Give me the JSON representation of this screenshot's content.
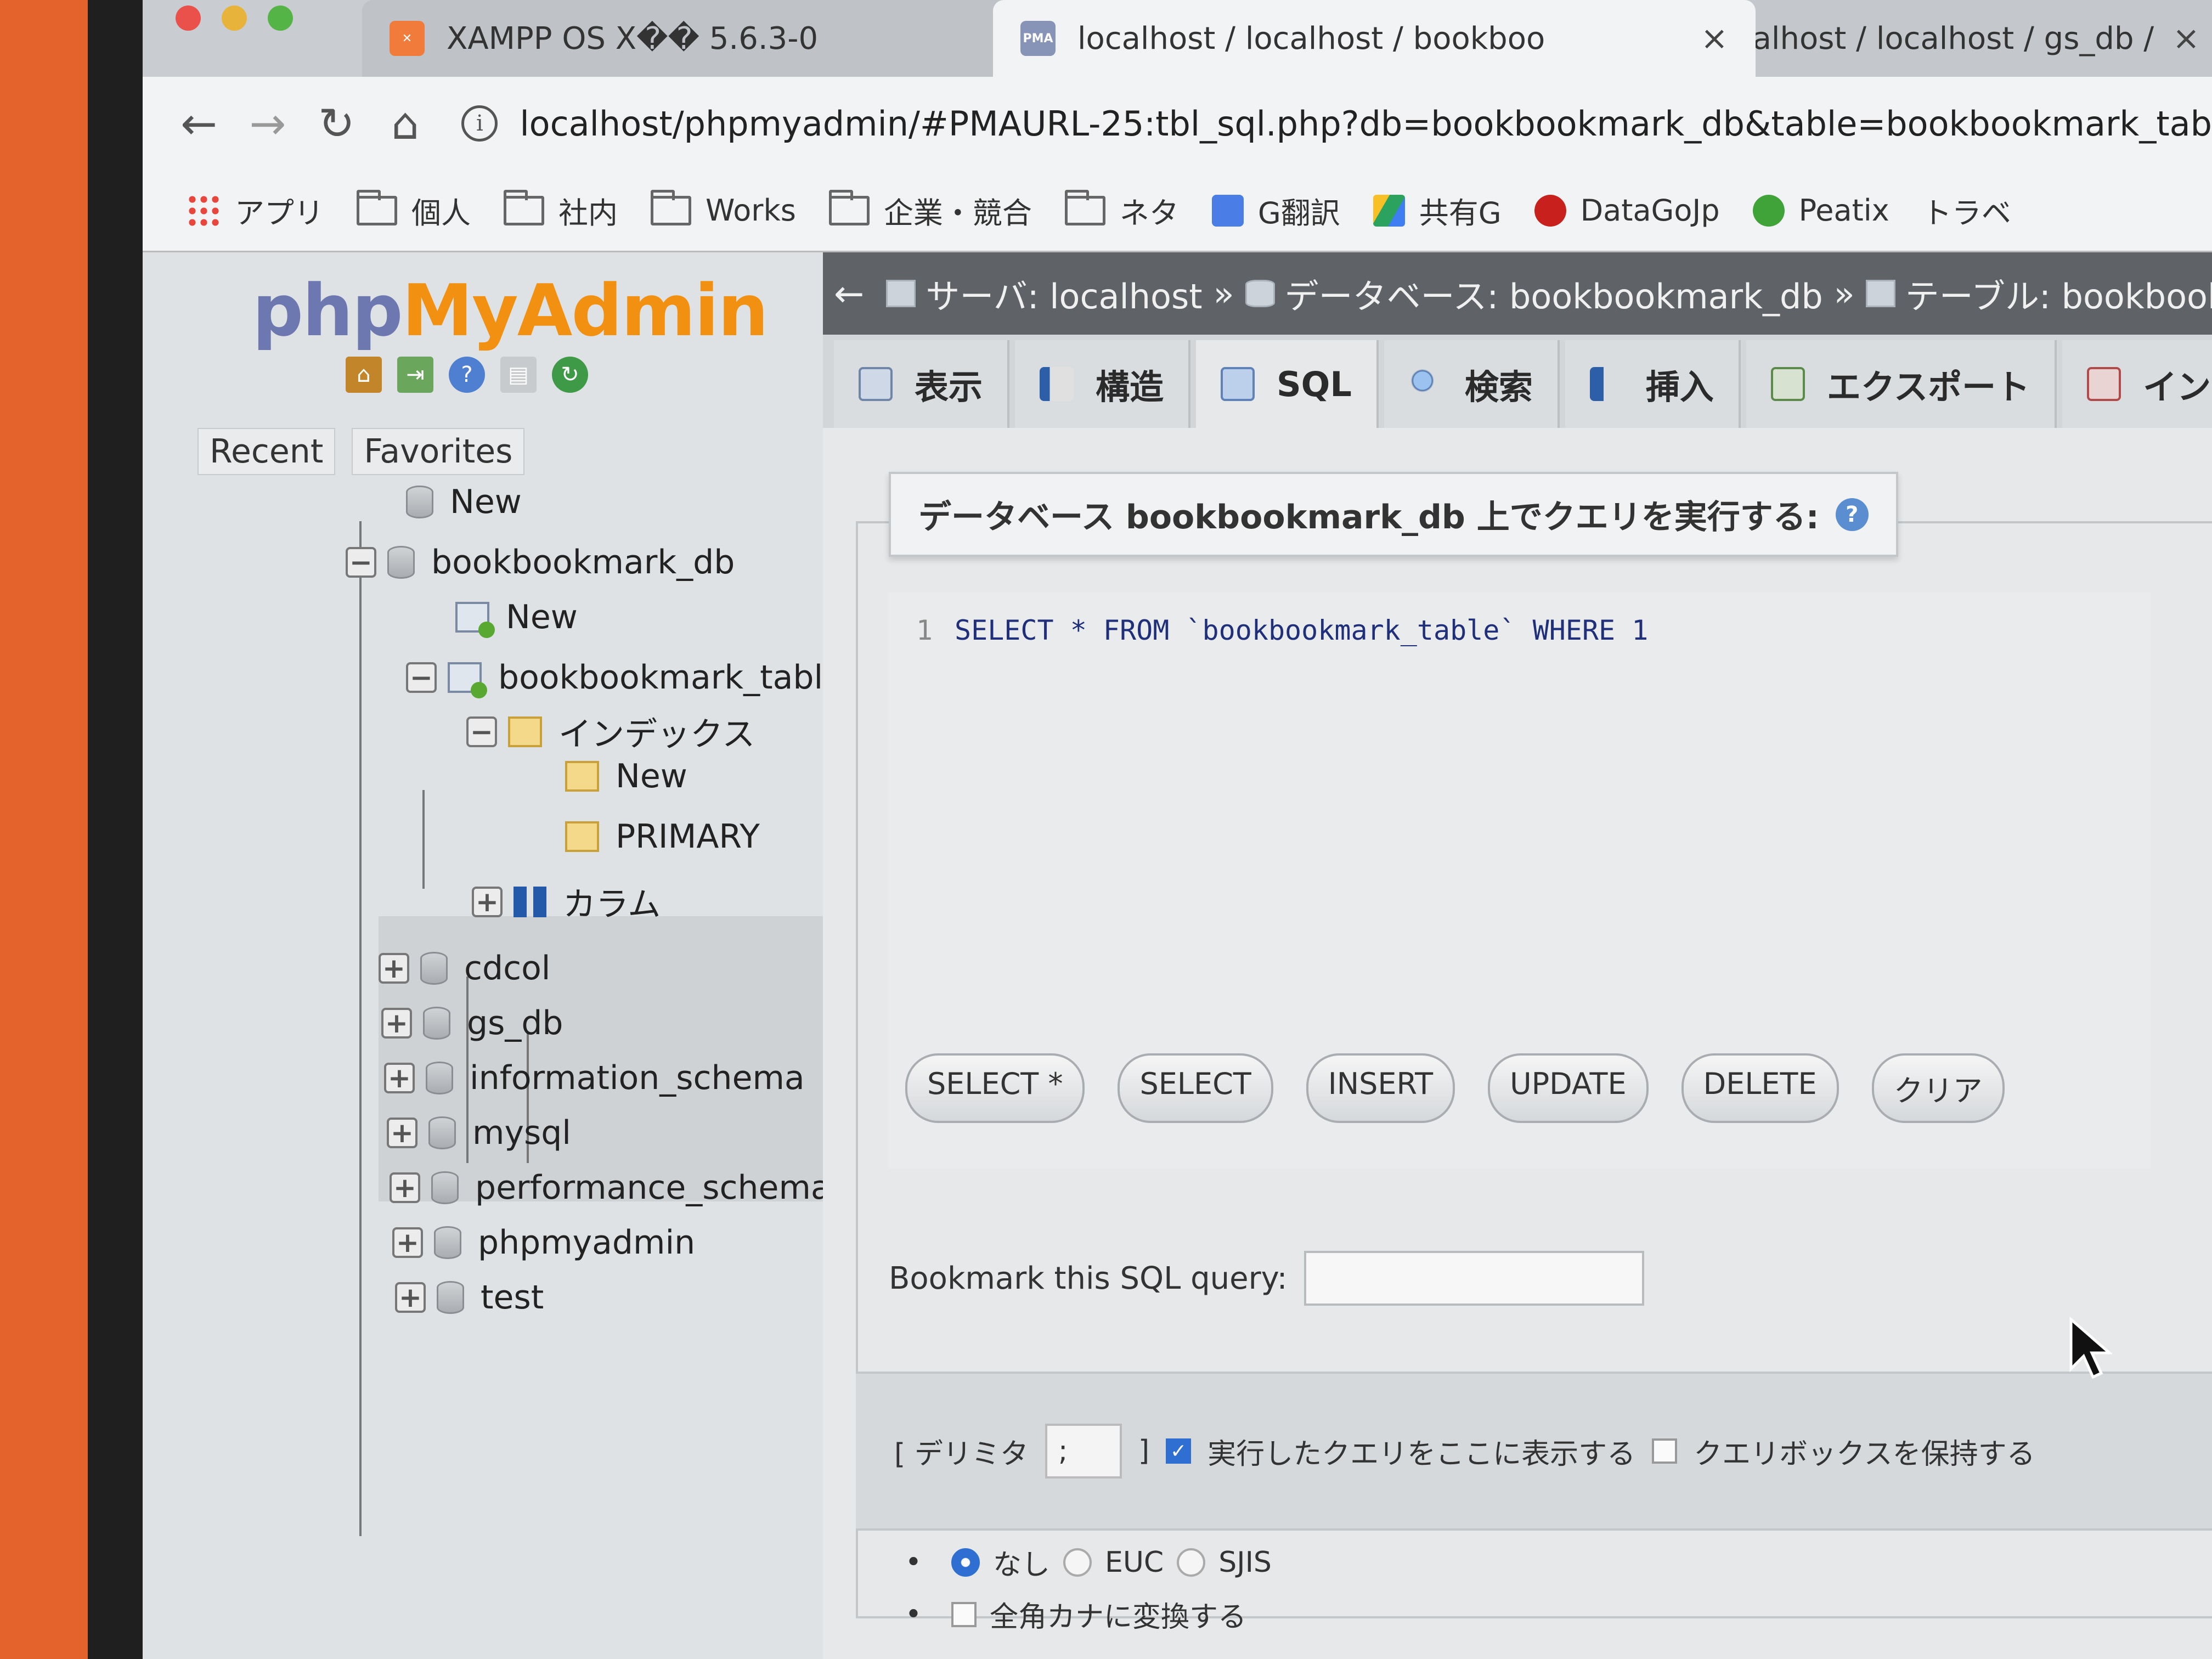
{
  "browser": {
    "tabs": [
      {
        "title": "XAMPP OS X�� 5.6.3-0",
        "favicon": "xampp-icon",
        "close": "×"
      },
      {
        "title": "localhost / localhost / bookboo",
        "favicon": "pma-icon",
        "close": "×"
      },
      {
        "title": "localhost / localhost / gs_db / ",
        "favicon": "pma-icon",
        "close": "×"
      }
    ],
    "favicon_text": "PMA",
    "nav": {
      "back": "←",
      "forward": "→",
      "reload": "↻",
      "home": "⌂"
    },
    "url": "localhost/phpmyadmin/#PMAURL-25:tbl_sql.php?db=bookbookmark_db&table=bookbookmark_tab",
    "bookmarks": [
      {
        "label": "アプリ",
        "icon": "apps-icon"
      },
      {
        "label": "個人",
        "icon": "folder-icon"
      },
      {
        "label": "社内",
        "icon": "folder-icon"
      },
      {
        "label": "Works",
        "icon": "folder-icon"
      },
      {
        "label": "企業・競合",
        "icon": "folder-icon"
      },
      {
        "label": "ネタ",
        "icon": "folder-icon"
      },
      {
        "label": "G翻訳",
        "icon": "google-translate-icon"
      },
      {
        "label": "共有G",
        "icon": "google-drive-icon"
      },
      {
        "label": "DataGoJp",
        "icon": "red-dot-icon"
      },
      {
        "label": "Peatix",
        "icon": "peatix-icon"
      },
      {
        "label": "トラベ",
        "icon": ""
      }
    ]
  },
  "nav_panel": {
    "logo_php": "php",
    "logo_myadmin": "MyAdmin",
    "tabs": [
      "Recent",
      "Favorites"
    ],
    "tree": {
      "new_root": "New",
      "db_open": "bookbookmark_db",
      "db_new": "New",
      "table": "bookbookmark_table",
      "index_group": "インデックス",
      "index_new": "New",
      "index_primary": "PRIMARY",
      "columns": "カラム",
      "other_dbs": [
        "cdcol",
        "gs_db",
        "information_schema",
        "mysql",
        "performance_schema",
        "phpmyadmin",
        "test"
      ]
    }
  },
  "main": {
    "back_arrow": "←",
    "breadcrumb": [
      {
        "label": "サーバ: localhost"
      },
      {
        "label": "データベース: bookbookmark_db"
      },
      {
        "label": "テーブル: bookbookmark"
      }
    ],
    "breadcrumb_sep": "»",
    "tabs": [
      {
        "label": "表示",
        "active": false
      },
      {
        "label": "構造",
        "active": false
      },
      {
        "label": "SQL",
        "active": true
      },
      {
        "label": "検索",
        "active": false
      },
      {
        "label": "挿入",
        "active": false
      },
      {
        "label": "エクスポート",
        "active": false
      },
      {
        "label": "インポート",
        "active": false
      }
    ],
    "query_heading": "データベース bookbookmark_db 上でクエリを実行する:",
    "editor": {
      "line_number": "1",
      "code": "SELECT * FROM `bookbookmark_table` WHERE 1"
    },
    "sql_buttons": [
      "SELECT *",
      "SELECT",
      "INSERT",
      "UPDATE",
      "DELETE",
      "クリア"
    ],
    "bookmark_label": "Bookmark this SQL query:",
    "bookmark_value": "",
    "delimiter_label": "[ デリミタ",
    "delimiter_value": ";",
    "delimiter_close": "]",
    "show_query_label": "実行したクエリをここに表示する",
    "show_query_checked": true,
    "retain_box_label": "クエリボックスを保持する",
    "retain_box_checked": false,
    "charset_options": [
      "なし",
      "EUC",
      "SJIS"
    ],
    "charset_selected": "なし",
    "kana_label": "全角カナに変換する",
    "kana_checked": false
  },
  "colors": {
    "logo_php": "#6c78af",
    "logo_myadmin": "#f29111",
    "breadcrumb_bg": "#5f6367",
    "checkbox_on": "#2f6fd1"
  }
}
